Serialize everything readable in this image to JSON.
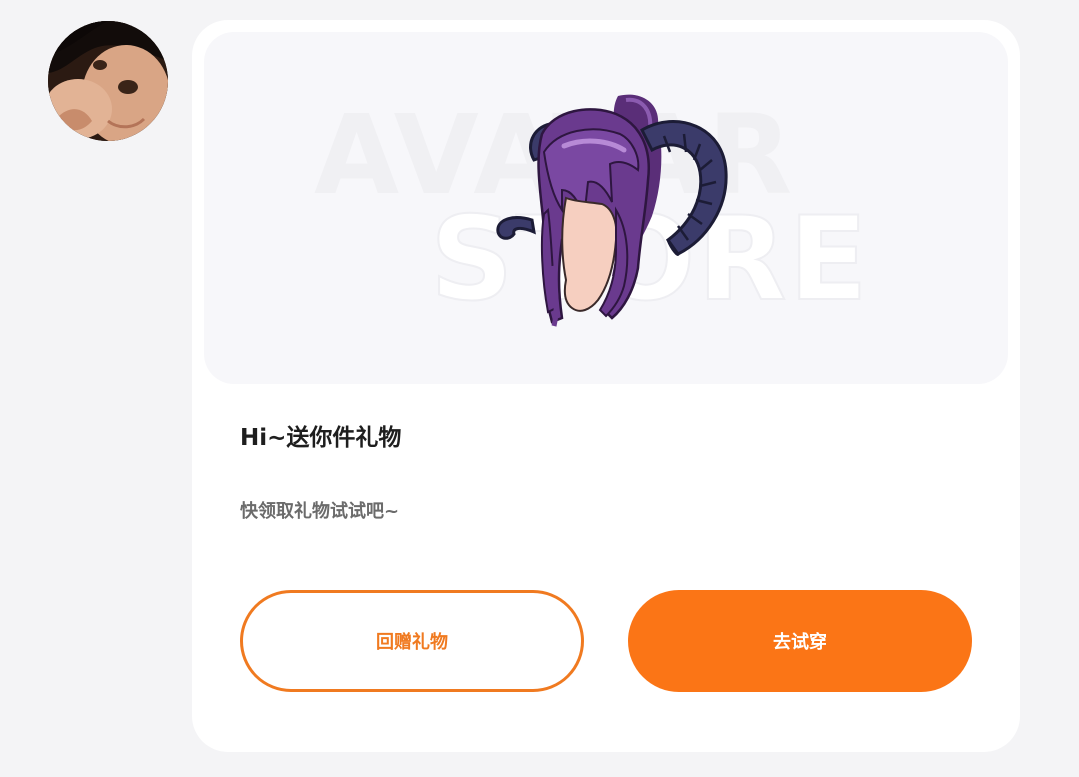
{
  "sender": {
    "avatar_icon": "user-avatar-photo"
  },
  "gift_card": {
    "preview": {
      "watermark_line1": "AVATAR",
      "watermark_line2": "STORE",
      "item_icon": "horned-purple-hair-accessory"
    },
    "title": "Hi~送你件礼物",
    "subtitle": "快领取礼物试试吧~",
    "buttons": {
      "return_gift_label": "回赠礼物",
      "try_on_label": "去试穿"
    }
  },
  "colors": {
    "accent": "#fb7516",
    "outline_accent": "#f07a20",
    "background": "#f4f4f6",
    "card": "#ffffff",
    "title_text": "#1e1e1e",
    "subtitle_text": "#6b6b6b"
  }
}
